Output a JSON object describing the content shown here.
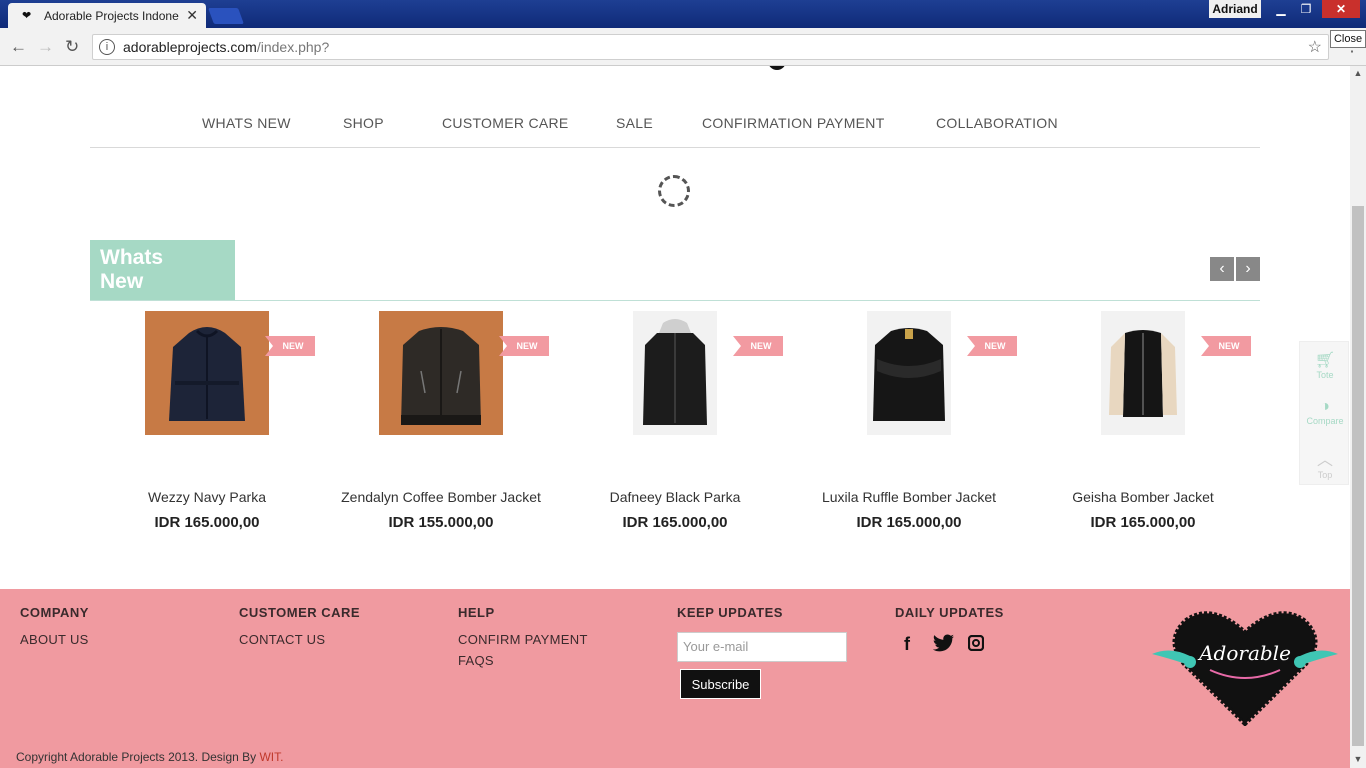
{
  "browser": {
    "tab_title": "Adorable Projects Indone",
    "tab_close_glyph": "✕",
    "user_name": "Adriand",
    "tooltip": "Close",
    "url_domain": "adorableprojects.com",
    "url_path": "/index.php?"
  },
  "nav": {
    "items": [
      "WHATS NEW",
      "SHOP",
      "CUSTOMER CARE",
      "SALE",
      "CONFIRMATION PAYMENT",
      "COLLABORATION"
    ]
  },
  "section": {
    "title_line1": "Whats",
    "title_line2": "New",
    "prev_glyph": "‹",
    "next_glyph": "›"
  },
  "products": [
    {
      "name": "Wezzy Navy Parka",
      "price": "IDR 165.000,00",
      "badge": "NEW",
      "bg": "#c77a45"
    },
    {
      "name": "Zendalyn Coffee Bomber Jacket",
      "price": "IDR 155.000,00",
      "badge": "NEW",
      "bg": "#c77a45"
    },
    {
      "name": "Dafneey Black Parka",
      "price": "IDR 165.000,00",
      "badge": "NEW",
      "bg": "#f2f2f2"
    },
    {
      "name": "Luxila Ruffle Bomber Jacket",
      "price": "IDR 165.000,00",
      "badge": "NEW",
      "bg": "#f2f2f2"
    },
    {
      "name": "Geisha Bomber Jacket",
      "price": "IDR 165.000,00",
      "badge": "NEW",
      "bg": "#f2f2f2"
    }
  ],
  "side_widget": {
    "tote": "Tote",
    "compare": "Compare",
    "top": "Top"
  },
  "footer": {
    "company_heading": "COMPANY",
    "about_us": "ABOUT US",
    "care_heading": "CUSTOMER CARE",
    "contact_us": "CONTACT US",
    "help_heading": "HELP",
    "confirm_payment": "CONFIRM PAYMENT",
    "faqs": "FAQS",
    "keep_heading": "KEEP UPDATES",
    "email_placeholder": "Your e-mail",
    "subscribe": "Subscribe",
    "daily_heading": "DAILY UPDATES",
    "logo_text": "Adorable",
    "copyright": "Copyright Adorable Projects 2013. Design By ",
    "designer": "WIT."
  },
  "colors": {
    "accent_mint": "#a6d9c5",
    "footer_pink": "#f09aa0",
    "badge_pink": "#f29aa1"
  }
}
